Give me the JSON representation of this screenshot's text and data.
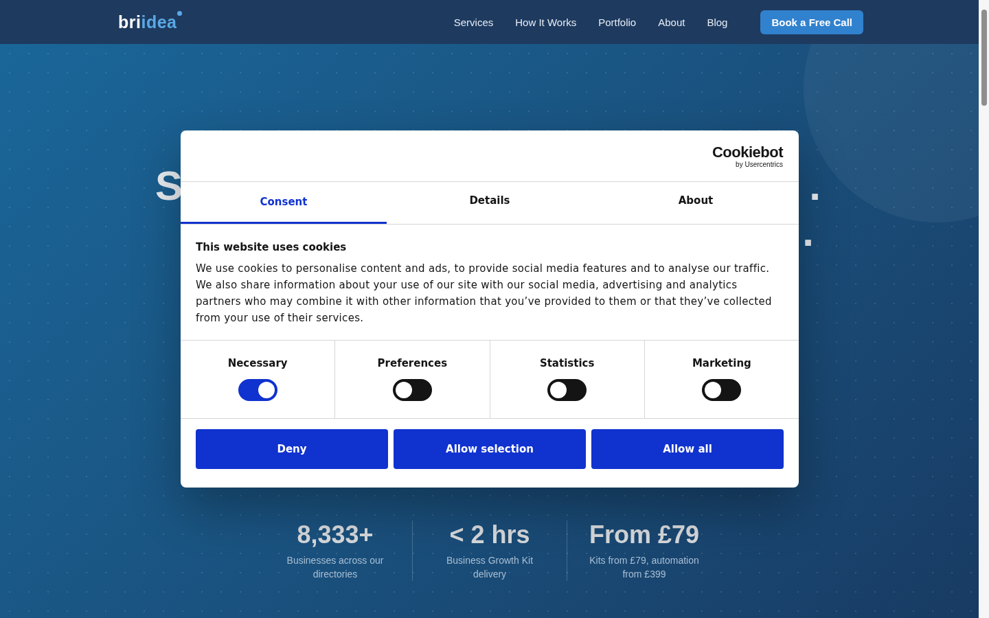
{
  "nav": {
    "logo": {
      "primary": "bri",
      "accent": "idea"
    },
    "links": [
      {
        "label": "Services"
      },
      {
        "label": "How It Works"
      },
      {
        "label": "Portfolio"
      },
      {
        "label": "About"
      },
      {
        "label": "Blog"
      }
    ],
    "cta": "Book a Free Call"
  },
  "hero": {
    "headline_fragments": [
      {
        "left": "S",
        "right": "."
      },
      {
        "right": "."
      }
    ],
    "stats": [
      {
        "value": "8,333+",
        "caption": "Businesses across our directories"
      },
      {
        "value": "< 2 hrs",
        "caption": "Business Growth Kit delivery"
      },
      {
        "value": "From £79",
        "caption": "Kits from £79, automation from £399"
      }
    ]
  },
  "cookie_dialog": {
    "brand": "Cookiebot",
    "brand_sub": "by Usercentrics",
    "tabs": [
      {
        "label": "Consent",
        "selected": true
      },
      {
        "label": "Details",
        "selected": false
      },
      {
        "label": "About",
        "selected": false
      }
    ],
    "title": "This website uses cookies",
    "body": "We use cookies to personalise content and ads, to provide social media features and to analyse our traffic. We also share information about your use of our site with our social media, advertising and analytics partners who may combine it with other information that you’ve provided to them or that they’ve collected from your use of their services.",
    "categories": [
      {
        "label": "Necessary",
        "on": true
      },
      {
        "label": "Preferences",
        "on": false
      },
      {
        "label": "Statistics",
        "on": false
      },
      {
        "label": "Marketing",
        "on": false
      }
    ],
    "buttons": [
      "Deny",
      "Allow selection",
      "Allow all"
    ]
  }
}
